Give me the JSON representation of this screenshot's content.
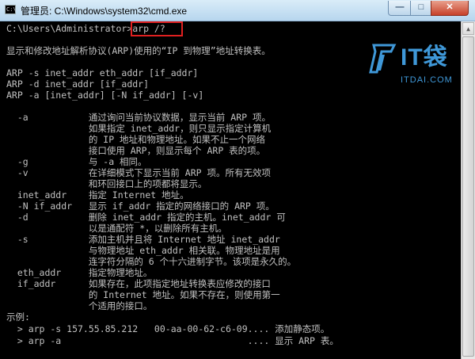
{
  "window": {
    "title": "管理员: C:\\Windows\\system32\\cmd.exe",
    "icon_text": "C:\\",
    "minimize_glyph": "—",
    "maximize_glyph": "□",
    "close_glyph": "✕"
  },
  "watermark": {
    "brand": "IT袋",
    "domain": "ITDAI.COM"
  },
  "console": {
    "lines": [
      "C:\\Users\\Administrator>arp /?",
      "",
      "显示和修改地址解析协议(ARP)使用的“IP 到物理”地址转换表。",
      "",
      "ARP -s inet_addr eth_addr [if_addr]",
      "ARP -d inet_addr [if_addr]",
      "ARP -a [inet_addr] [-N if_addr] [-v]",
      "",
      "  -a           通过询问当前协议数据，显示当前 ARP 项。",
      "               如果指定 inet_addr，则只显示指定计算机",
      "               的 IP 地址和物理地址。如果不止一个网络",
      "               接口使用 ARP，则显示每个 ARP 表的项。",
      "  -g           与 -a 相同。",
      "  -v           在详细模式下显示当前 ARP 项。所有无效项",
      "               和环回接口上的项都将显示。",
      "  inet_addr    指定 Internet 地址。",
      "  -N if_addr   显示 if_addr 指定的网络接口的 ARP 项。",
      "  -d           删除 inet_addr 指定的主机。inet_addr 可",
      "               以是通配符 *，以删除所有主机。",
      "  -s           添加主机并且将 Internet 地址 inet_addr",
      "               与物理地址 eth_addr 相关联。物理地址是用",
      "               连字符分隔的 6 个十六进制字节。该项是永久的。",
      "  eth_addr     指定物理地址。",
      "  if_addr      如果存在，此项指定地址转换表应修改的接口",
      "               的 Internet 地址。如果不存在，则使用第一",
      "               个适用的接口。",
      "示例:",
      "  > arp -s 157.55.85.212   00-aa-00-62-c6-09.... 添加静态项。",
      "  > arp -a                                  .... 显示 ARP 表。"
    ]
  }
}
